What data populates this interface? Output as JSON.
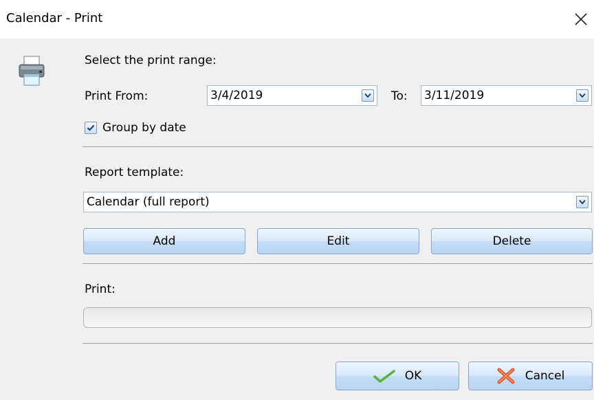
{
  "window": {
    "title": "Calendar - Print"
  },
  "range": {
    "heading": "Select the print range:",
    "from_label": "Print From:",
    "from_value": "3/4/2019",
    "to_label": "To:",
    "to_value": "3/11/2019",
    "group_by_date_label": "Group by date",
    "group_by_date_checked": true
  },
  "template": {
    "label": "Report template:",
    "selected": "Calendar (full report)",
    "add_label": "Add",
    "edit_label": "Edit",
    "delete_label": "Delete"
  },
  "print": {
    "label": "Print:",
    "progress": 0
  },
  "footer": {
    "ok_label": "OK",
    "cancel_label": "Cancel"
  },
  "icons": {
    "printer": "printer-icon",
    "dropdown": "chevron-down-icon",
    "checkbox": "checkmark-icon",
    "ok": "green-checkmark-icon",
    "cancel": "red-x-icon",
    "close": "close-icon"
  }
}
